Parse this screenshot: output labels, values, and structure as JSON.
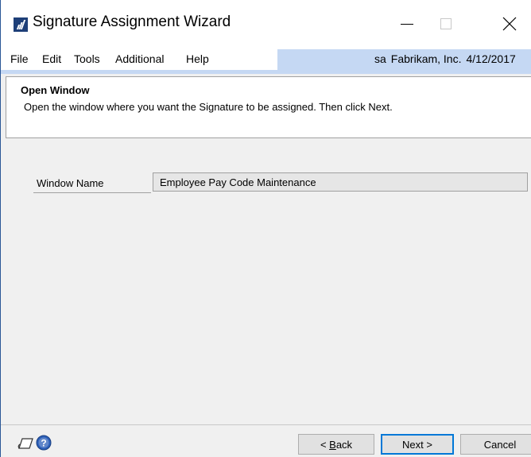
{
  "window": {
    "title": "Signature Assignment Wizard"
  },
  "menu": {
    "items": [
      "File",
      "Edit",
      "Tools",
      "Additional",
      "Help"
    ],
    "user": "sa",
    "company": "Fabrikam, Inc.",
    "date": "4/12/2017"
  },
  "header": {
    "title": "Open Window",
    "description": "Open the window where you want the Signature to be assigned. Then click Next."
  },
  "form": {
    "window_name_label": "Window Name",
    "window_name_value": "Employee Pay Code Maintenance"
  },
  "footer": {
    "back_prefix": "< ",
    "back_accel": "B",
    "back_rest": "ack",
    "next_label": "Next >",
    "cancel_label": "Cancel"
  },
  "icons": {
    "app": "app-logo-icon",
    "minimize": "minimize-icon",
    "maximize": "maximize-icon",
    "close": "close-icon",
    "note": "note-icon",
    "help": "help-icon"
  },
  "colors": {
    "accent": "#0078d7",
    "menubar_highlight": "#c5d8f3",
    "app_icon": "#1e3f78"
  }
}
